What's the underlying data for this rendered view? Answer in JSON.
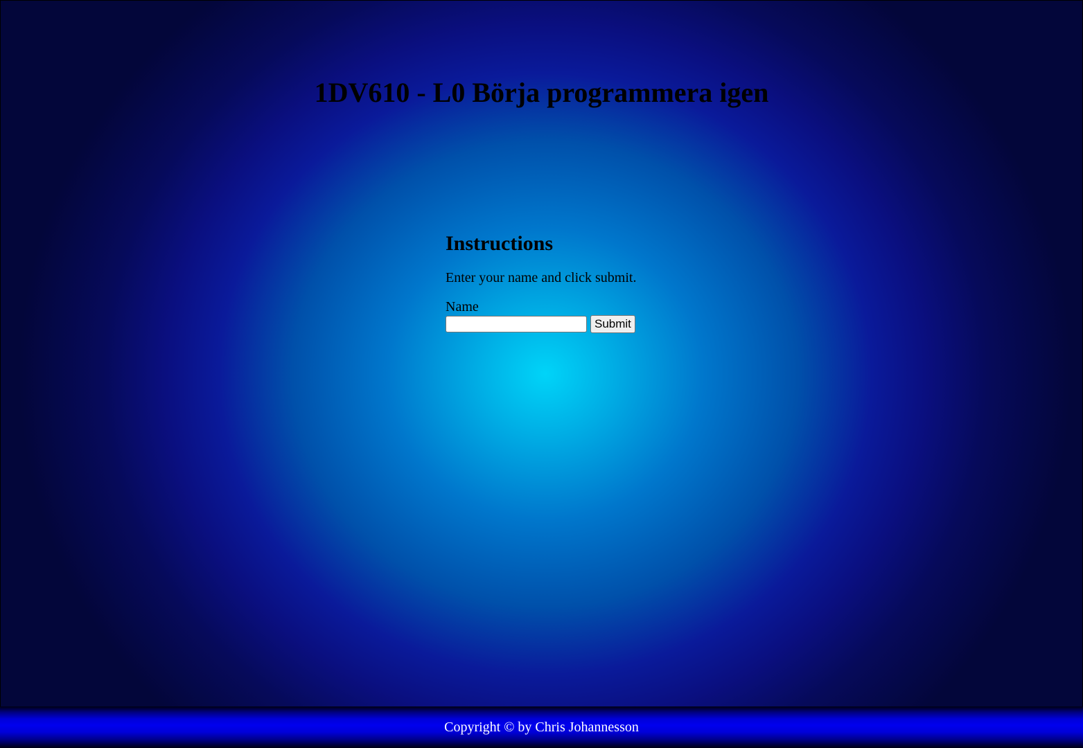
{
  "header": {
    "title": "1DV610 - L0 Börja programmera igen"
  },
  "main": {
    "heading": "Instructions",
    "instruction_text": "Enter your name and click submit.",
    "form": {
      "name_label": "Name",
      "name_value": "",
      "name_placeholder": "",
      "submit_label": "Submit"
    }
  },
  "footer": {
    "copyright": "Copyright © by Chris Johannesson"
  },
  "colors": {
    "center_glow": "#00d4f8",
    "outer_background": "#03063a",
    "footer_band": "#0000ee",
    "footer_text": "#ffffff"
  }
}
